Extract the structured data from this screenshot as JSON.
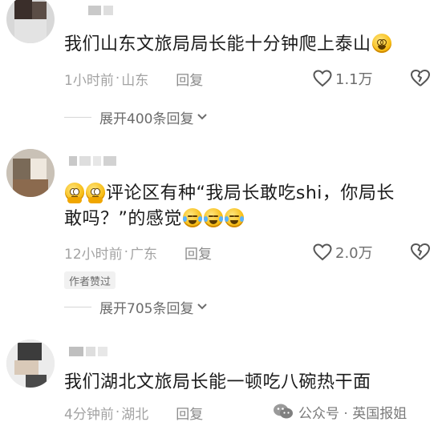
{
  "comments": [
    {
      "text": "我们山东文旅局局长能十分钟爬上泰山",
      "emoji_after": "dizzy-face-icon",
      "time": "1小时前",
      "location": "山东",
      "reply_label": "回复",
      "likes": "1.1万",
      "expand_label": "展开400条回复"
    },
    {
      "emoji_before": [
        "begging-face-icon",
        "begging-face-icon"
      ],
      "text_line1": "评论区有种“我局长敢吃shi，你局长",
      "text_line2": "敢吗？”的感觉",
      "emoji_after": [
        "laughing-crying-icon",
        "laughing-crying-icon",
        "laughing-crying-icon"
      ],
      "time": "12小时前",
      "location": "广东",
      "reply_label": "回复",
      "likes": "2.0万",
      "author_badge": "作者赞过",
      "expand_label": "展开705条回复"
    },
    {
      "text": "我们湖北文旅局长能一顿吃八碗热干面",
      "time": "4分钟前",
      "location": "湖北",
      "reply_label": "回复"
    }
  ],
  "separator": "·",
  "watermark": {
    "icon": "wechat-icon",
    "text": "公众号 · 英国报姐"
  },
  "colors": {
    "text": "#1c1c1c",
    "meta": "#a3a3a3",
    "badge_bg": "#f1f1f1"
  }
}
